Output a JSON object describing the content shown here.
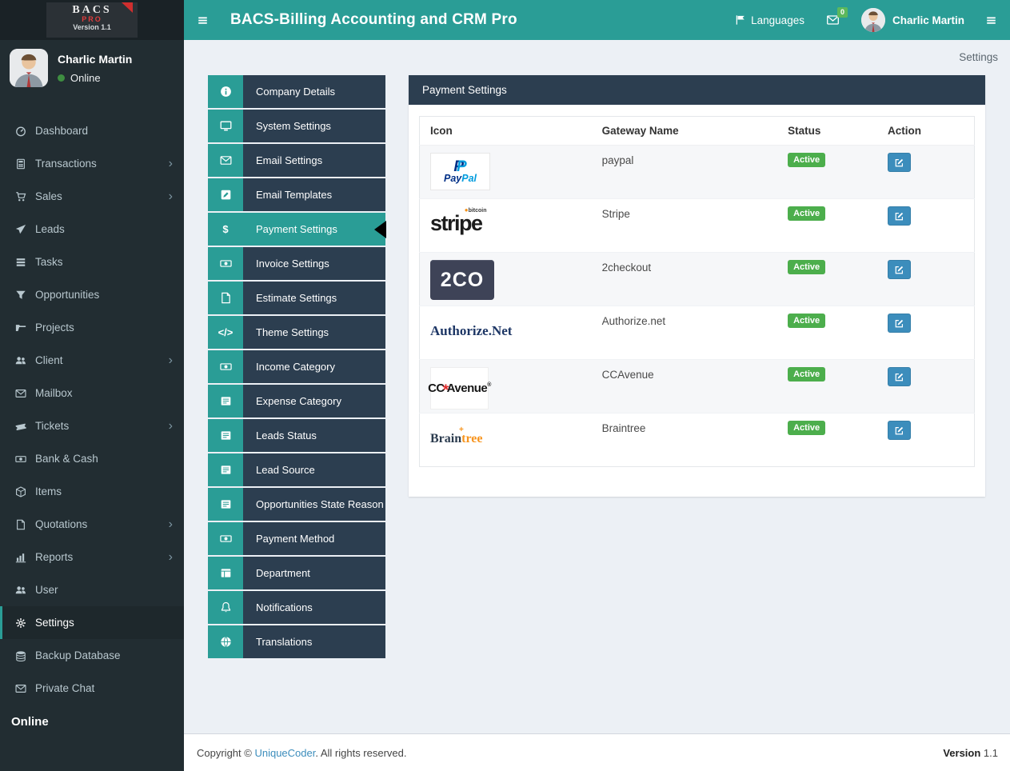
{
  "app": {
    "title": "BACS-Billing Accounting and CRM Pro"
  },
  "logo": {
    "line1": "BACS",
    "line2": "PRO",
    "line3": "Version 1.1"
  },
  "header": {
    "languages_label": "Languages",
    "mail_badge": "0",
    "user_name": "Charlic Martin"
  },
  "sidebar": {
    "user": {
      "name": "Charlic Martin",
      "status": "Online"
    },
    "items": [
      {
        "icon": "gauge-icon",
        "label": "Dashboard",
        "chevron": false,
        "active": false
      },
      {
        "icon": "calculator-icon",
        "label": "Transactions",
        "chevron": true,
        "active": false
      },
      {
        "icon": "cart-icon",
        "label": "Sales",
        "chevron": true,
        "active": false
      },
      {
        "icon": "send-icon",
        "label": "Leads",
        "chevron": false,
        "active": false
      },
      {
        "icon": "tasks-icon",
        "label": "Tasks",
        "chevron": false,
        "active": false
      },
      {
        "icon": "filter-icon",
        "label": "Opportunities",
        "chevron": false,
        "active": false
      },
      {
        "icon": "folder-icon",
        "label": "Projects",
        "chevron": false,
        "active": false
      },
      {
        "icon": "users-icon",
        "label": "Client",
        "chevron": true,
        "active": false
      },
      {
        "icon": "envelope-icon",
        "label": "Mailbox",
        "chevron": false,
        "active": false
      },
      {
        "icon": "ticket-icon",
        "label": "Tickets",
        "chevron": true,
        "active": false
      },
      {
        "icon": "money-icon",
        "label": "Bank & Cash",
        "chevron": false,
        "active": false
      },
      {
        "icon": "cube-icon",
        "label": "Items",
        "chevron": false,
        "active": false
      },
      {
        "icon": "file-icon",
        "label": "Quotations",
        "chevron": true,
        "active": false
      },
      {
        "icon": "chart-icon",
        "label": "Reports",
        "chevron": true,
        "active": false
      },
      {
        "icon": "users-icon",
        "label": "User",
        "chevron": false,
        "active": false
      },
      {
        "icon": "cogs-icon",
        "label": "Settings",
        "chevron": false,
        "active": true
      },
      {
        "icon": "database-icon",
        "label": "Backup Database",
        "chevron": false,
        "active": false
      },
      {
        "icon": "envelope-icon",
        "label": "Private Chat",
        "chevron": false,
        "active": false
      }
    ],
    "section_label": "Online"
  },
  "breadcrumb": "Settings",
  "settings_menu": {
    "items": [
      {
        "icon": "info-icon",
        "label": "Company Details",
        "active": false
      },
      {
        "icon": "desktop-icon",
        "label": "System Settings",
        "active": false
      },
      {
        "icon": "envelope-icon",
        "label": "Email Settings",
        "active": false
      },
      {
        "icon": "pencil-square-icon",
        "label": "Email Templates",
        "active": false
      },
      {
        "icon": "dollar-icon",
        "label": "Payment Settings",
        "active": true
      },
      {
        "icon": "money-icon",
        "label": "Invoice Settings",
        "active": false
      },
      {
        "icon": "file-icon",
        "label": "Estimate Settings",
        "active": false
      },
      {
        "icon": "code-icon",
        "label": "Theme Settings",
        "active": false
      },
      {
        "icon": "money-icon",
        "label": "Income Category",
        "active": false
      },
      {
        "icon": "list-icon",
        "label": "Expense Category",
        "active": false
      },
      {
        "icon": "list-icon",
        "label": "Leads Status",
        "active": false
      },
      {
        "icon": "list-icon",
        "label": "Lead Source",
        "active": false
      },
      {
        "icon": "list-icon",
        "label": "Opportunities State Reason",
        "active": false
      },
      {
        "icon": "money-icon",
        "label": "Payment Method",
        "active": false
      },
      {
        "icon": "table-icon",
        "label": "Department",
        "active": false
      },
      {
        "icon": "bell-icon",
        "label": "Notifications",
        "active": false
      },
      {
        "icon": "globe-icon",
        "label": "Translations",
        "active": false
      }
    ]
  },
  "panel": {
    "title": "Payment Settings"
  },
  "table": {
    "columns": [
      "Icon",
      "Gateway Name",
      "Status",
      "Action"
    ],
    "rows": [
      {
        "gateway": "paypal",
        "status": "Active",
        "logo": {
          "type": "paypal",
          "mark": "P",
          "text1": "Pay",
          "text2": "Pal"
        }
      },
      {
        "gateway": "Stripe",
        "status": "Active",
        "logo": {
          "type": "stripe",
          "text": "stripe",
          "tag": "bitcoin"
        }
      },
      {
        "gateway": "2checkout",
        "status": "Active",
        "logo": {
          "type": "2co",
          "text": "2CO"
        }
      },
      {
        "gateway": "Authorize.net",
        "status": "Active",
        "logo": {
          "type": "authorize",
          "text": "Authorize.Net"
        }
      },
      {
        "gateway": "CCAvenue",
        "status": "Active",
        "logo": {
          "type": "ccavenue",
          "text1": "CC",
          "text2": "Avenue",
          "reg": "®"
        }
      },
      {
        "gateway": "Braintree",
        "status": "Active",
        "logo": {
          "type": "braintree",
          "text1": "Brain",
          "text2": "tree",
          "plus": "+"
        }
      }
    ]
  },
  "footer": {
    "copyright_prefix": "Copyright © ",
    "link": "UniqueCoder",
    "suffix": ". All rights reserved.",
    "version_label": "Version",
    "version": "1.1"
  },
  "colors": {
    "teal": "#2a9d96",
    "navy": "#2c3e50",
    "sidebar": "#222d32",
    "green": "#4cae4c",
    "blue": "#3c8dbc",
    "body_bg": "#ecf0f5"
  }
}
